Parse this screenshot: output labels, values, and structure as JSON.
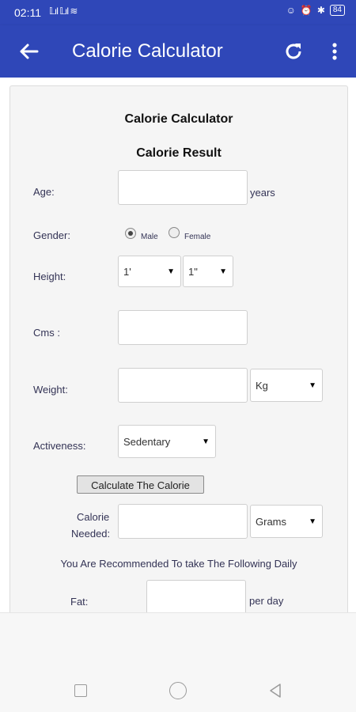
{
  "status_bar": {
    "time": "02:11",
    "signal": "𝕃ıl 𝕃ıl ≋",
    "battery": "84"
  },
  "app_bar": {
    "title": "Calorie Calculator"
  },
  "form": {
    "heading": "Calorie Calculator",
    "subheading": "Calorie Result",
    "age": {
      "label": "Age:",
      "value": "",
      "unit": "years"
    },
    "gender": {
      "label": "Gender:",
      "options": [
        {
          "label": "Male",
          "checked": true
        },
        {
          "label": "Female",
          "checked": false
        }
      ]
    },
    "height": {
      "label": "Height:",
      "feet": "1'",
      "inches": "1\""
    },
    "cms": {
      "label": "Cms :",
      "value": ""
    },
    "weight": {
      "label": "Weight:",
      "value": "",
      "unit": "Kg"
    },
    "activeness": {
      "label": "Activeness:",
      "value": "Sedentary"
    },
    "calculate_button": "Calculate The Calorie",
    "calorie_needed": {
      "label_line1": "Calorie",
      "label_line2": "Needed:",
      "value": "",
      "unit": "Grams"
    },
    "recommend_text": "You Are Recommended To take The Following Daily",
    "fat": {
      "label": "Fat:",
      "value": "",
      "unit": "per day"
    }
  },
  "colors": {
    "app_bar": "#2f47b8",
    "card_bg": "#f5f5f5",
    "label_text": "#333355"
  }
}
